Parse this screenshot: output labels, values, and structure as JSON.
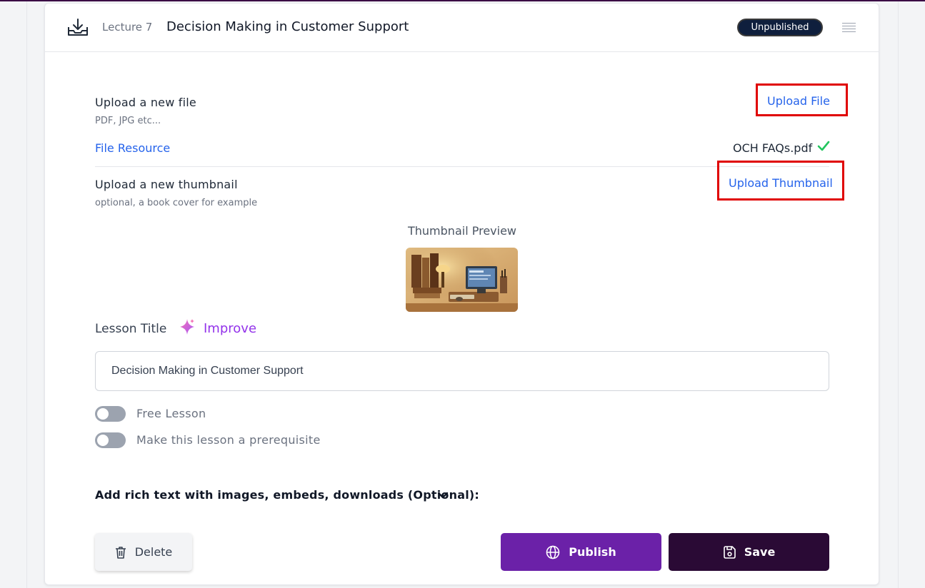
{
  "header": {
    "lecture_label": "Lecture 7",
    "title": "Decision Making in Customer Support",
    "status_badge": "Unpublished"
  },
  "file_upload": {
    "label": "Upload a new file",
    "hint": "PDF, JPG etc...",
    "button": "Upload File",
    "resource_label": "File Resource",
    "file_name": "OCH FAQs.pdf"
  },
  "thumbnail_upload": {
    "label": "Upload a new thumbnail",
    "hint": "optional, a book cover for example",
    "button": "Upload Thumbnail",
    "preview_label": "Thumbnail Preview"
  },
  "lesson_title": {
    "label": "Lesson Title",
    "improve_label": "Improve",
    "value": "Decision Making in Customer Support"
  },
  "toggles": {
    "free_lesson": {
      "label": "Free Lesson",
      "on": false
    },
    "prerequisite": {
      "label": "Make this lesson a prerequisite",
      "on": false
    }
  },
  "rich_text": {
    "label": "Add rich text with images, embeds, downloads (Optional):"
  },
  "actions": {
    "delete": "Delete",
    "publish": "Publish",
    "save": "Save"
  },
  "colors": {
    "accent_link": "#2563eb",
    "publish": "#6b21a8",
    "save": "#2a0a35",
    "badge": "#0f1f3d",
    "highlight_box": "#e00000",
    "check": "#22c55e"
  }
}
